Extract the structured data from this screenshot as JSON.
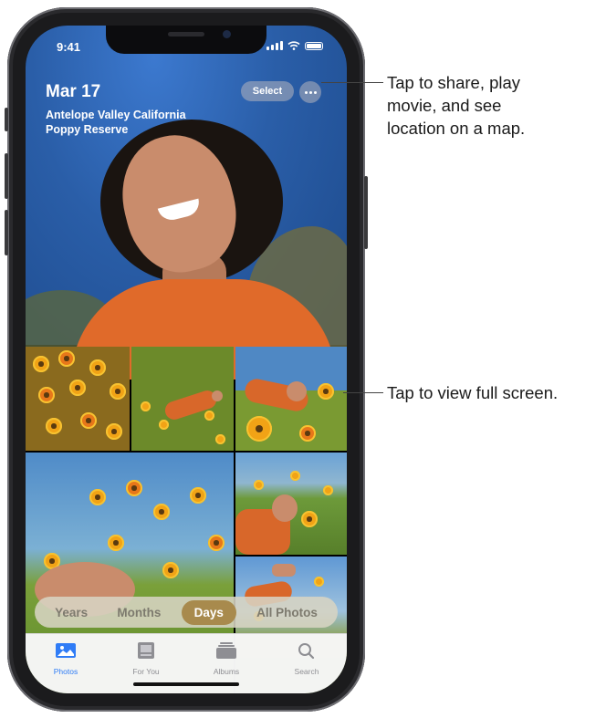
{
  "status_bar": {
    "time": "9:41"
  },
  "header": {
    "date": "Mar 17",
    "location_lines": [
      "Antelope Valley California",
      "Poppy Reserve"
    ],
    "select_label": "Select",
    "more_icon": "ellipsis-icon"
  },
  "segmented_control": {
    "options": [
      "Years",
      "Months",
      "Days",
      "All Photos"
    ],
    "selected": "Days"
  },
  "tab_bar": {
    "tabs": [
      {
        "label": "Photos",
        "icon": "photos-icon",
        "active": true
      },
      {
        "label": "For You",
        "icon": "for-you-icon",
        "active": false
      },
      {
        "label": "Albums",
        "icon": "albums-icon",
        "active": false
      },
      {
        "label": "Search",
        "icon": "search-icon",
        "active": false
      }
    ]
  },
  "callouts": {
    "top": [
      "Tap to share, play",
      "movie, and see",
      "location on a map."
    ],
    "middle": "Tap to view full screen."
  },
  "colors": {
    "accent_blue": "#2f7cf6",
    "segment_active": "#a88a4d",
    "hero_sky": "#2a5ea8"
  }
}
